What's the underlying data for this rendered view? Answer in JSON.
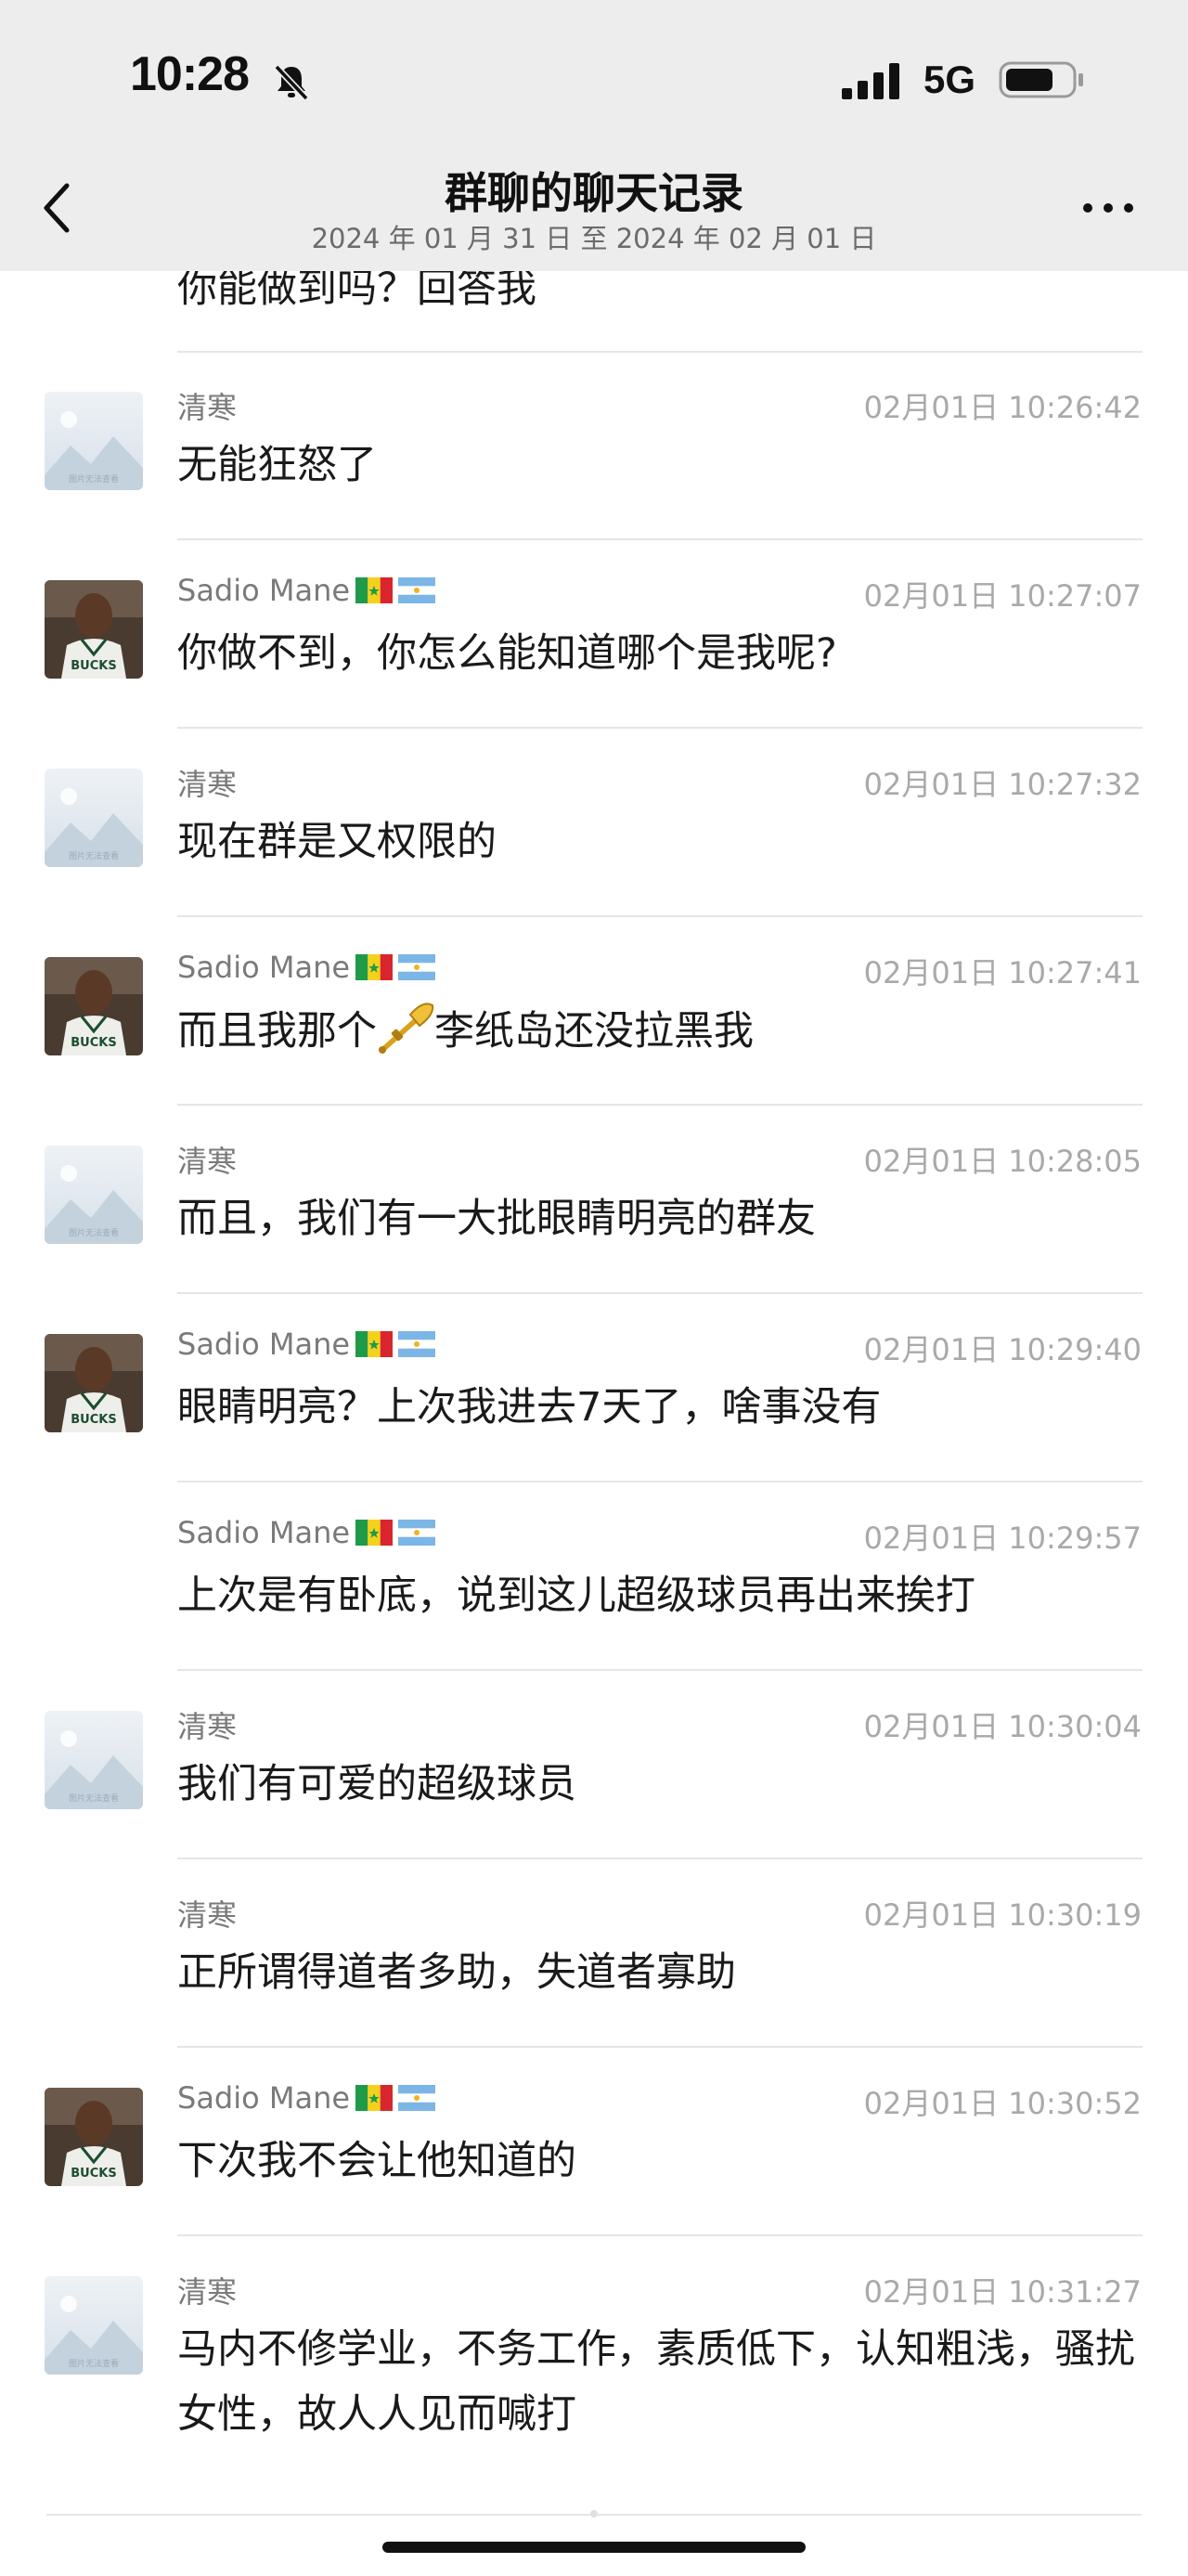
{
  "status_bar": {
    "time": "10:28",
    "network": "5G"
  },
  "header": {
    "title": "群聊的聊天记录",
    "subtitle": "2024 年 01 月 31 日 至 2024 年 02 月 01 日"
  },
  "partial_message": "你能做到吗？回答我",
  "avatar_placeholder_text": "图片无法查看",
  "messages": [
    {
      "sender": "清寒",
      "time": "02月01日 10:26:42",
      "text": "无能狂怒了",
      "avatar": "placeholder"
    },
    {
      "sender": "Sadio Mane",
      "time": "02月01日 10:27:07",
      "text": "你做不到，你怎么能知道哪个是我呢?",
      "avatar": "photo"
    },
    {
      "sender": "清寒",
      "time": "02月01日 10:27:32",
      "text": "现在群是又权限的",
      "avatar": "placeholder"
    },
    {
      "sender": "Sadio Mane",
      "time": "02月01日 10:27:41",
      "text_before": "而且我那个",
      "text_after": "李纸岛还没拉黑我",
      "avatar": "photo"
    },
    {
      "sender": "清寒",
      "time": "02月01日 10:28:05",
      "text": "而且，我们有一大批眼睛明亮的群友",
      "avatar": "placeholder"
    },
    {
      "sender": "Sadio Mane",
      "time": "02月01日 10:29:40",
      "text": "眼睛明亮？上次我进去7天了，啥事没有",
      "avatar": "photo"
    },
    {
      "sender": "Sadio Mane",
      "time": "02月01日 10:29:57",
      "text": "上次是有卧底，说到这儿超级球员再出来挨打",
      "avatar": "none"
    },
    {
      "sender": "清寒",
      "time": "02月01日 10:30:04",
      "text": "我们有可爱的超级球员",
      "avatar": "placeholder"
    },
    {
      "sender": "清寒",
      "time": "02月01日 10:30:19",
      "text": "正所谓得道者多助，失道者寡助",
      "avatar": "none"
    },
    {
      "sender": "Sadio Mane",
      "time": "02月01日 10:30:52",
      "text": "下次我不会让他知道的",
      "avatar": "photo"
    },
    {
      "sender": "清寒",
      "time": "02月01日 10:31:27",
      "text": "马内不修学业，不务工作，素质低下，认知粗浅，骚扰女性，故人人见而喊打",
      "avatar": "placeholder"
    }
  ]
}
